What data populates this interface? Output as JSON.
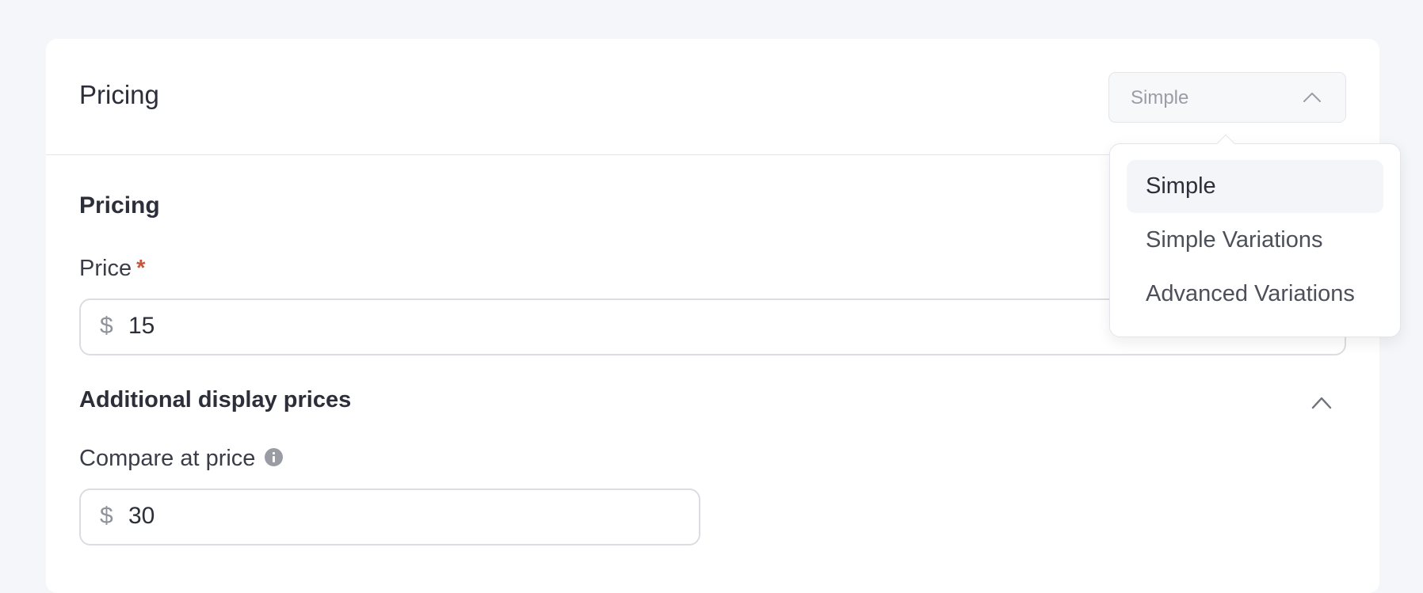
{
  "card": {
    "title": "Pricing",
    "type_select": {
      "value": "Simple",
      "chevron_icon": "chevron-up-icon"
    }
  },
  "section": {
    "title": "Pricing"
  },
  "price_field": {
    "label": "Price",
    "required_mark": "*",
    "currency": "$",
    "value": "15"
  },
  "additional": {
    "title": "Additional display prices",
    "chevron_icon": "chevron-up-icon"
  },
  "compare_field": {
    "label": "Compare at price",
    "info_icon": "info-icon",
    "currency": "$",
    "value": "30"
  },
  "dropdown": {
    "options": [
      {
        "label": "Simple",
        "selected": true
      },
      {
        "label": "Simple Variations",
        "selected": false
      },
      {
        "label": "Advanced Variations",
        "selected": false
      }
    ]
  },
  "colors": {
    "page_bg": "#f5f6f9",
    "card_bg": "#ffffff",
    "text": "#2c2f3a",
    "required": "#c8553a",
    "muted": "#9a9ca6",
    "border": "#dcdde2",
    "selected_bg": "#f4f5f8"
  }
}
